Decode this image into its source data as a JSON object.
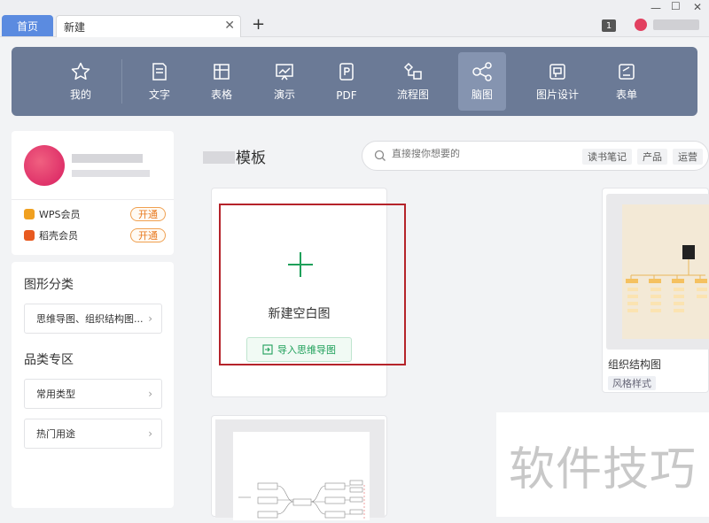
{
  "tabs": {
    "home_label": "首页",
    "new_label": "新建",
    "close_glyph": "✕",
    "add_glyph": "+"
  },
  "window": {
    "minimize": "—",
    "maximize": "☐",
    "close": "✕",
    "notification_count": "1"
  },
  "toolbar": {
    "items": [
      {
        "label": "我的",
        "icon": "star-icon"
      },
      {
        "label": "文字",
        "icon": "document-icon"
      },
      {
        "label": "表格",
        "icon": "table-icon"
      },
      {
        "label": "演示",
        "icon": "presentation-icon"
      },
      {
        "label": "PDF",
        "icon": "pdf-icon"
      },
      {
        "label": "流程图",
        "icon": "flowchart-icon"
      },
      {
        "label": "脑图",
        "icon": "mindmap-icon"
      },
      {
        "label": "图片设计",
        "icon": "image-design-icon"
      },
      {
        "label": "表单",
        "icon": "form-icon"
      }
    ],
    "active_index": 6
  },
  "sidebar": {
    "memberships": [
      {
        "name": "WPS会员",
        "action": "开通",
        "color": "#f0a020"
      },
      {
        "name": "稻壳会员",
        "action": "开通",
        "color": "#e85a20"
      }
    ],
    "shape_section_title": "图形分类",
    "shape_items": [
      "思维导图、组织结构图..."
    ],
    "category_section_title": "品类专区",
    "category_items": [
      "常用类型",
      "热门用途"
    ]
  },
  "main": {
    "title_suffix": "模板",
    "search": {
      "placeholder": "直接搜你想要的",
      "tags": [
        "读书笔记",
        "产品",
        "运营"
      ]
    },
    "new_card": {
      "label": "新建空白图",
      "import_label": "导入思维导图"
    },
    "org_card": {
      "label": "组织结构图",
      "tag": "风格样式"
    },
    "watermark": "软件技巧"
  },
  "colors": {
    "toolbar_bg": "#6b7a96",
    "accent_green": "#1fa05a",
    "highlight_red": "#b5232a",
    "home_tab": "#5b8be0"
  }
}
